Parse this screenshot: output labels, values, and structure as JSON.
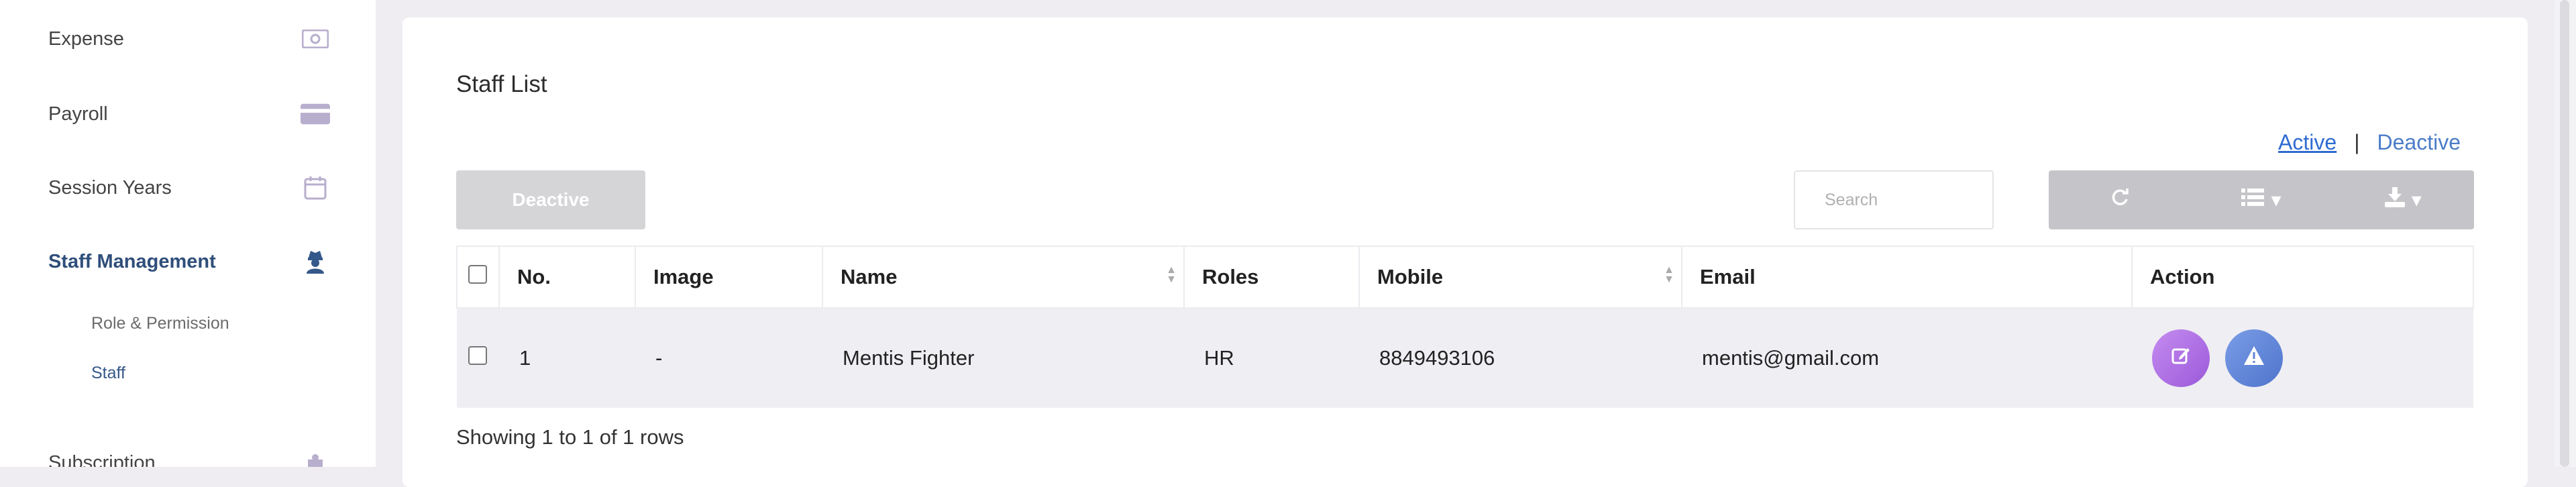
{
  "sidebar": {
    "items": [
      {
        "label": "Expense",
        "icon": "money-bill-icon"
      },
      {
        "label": "Payroll",
        "icon": "credit-card-icon"
      },
      {
        "label": "Session Years",
        "icon": "calendar-icon"
      },
      {
        "label": "Staff Management",
        "icon": "user-secret-icon",
        "active": true
      },
      {
        "label": "Subscription",
        "icon": "puzzle-icon"
      }
    ],
    "sub_items": [
      {
        "label": "Role & Permission"
      },
      {
        "label": "Staff",
        "active": true
      }
    ]
  },
  "card": {
    "title": "Staff List",
    "status": {
      "active_label": "Active",
      "separator": "|",
      "deactive_label": "Deactive"
    },
    "deactive_button": "Deactive",
    "search_placeholder": "Search"
  },
  "table": {
    "headers": [
      "No.",
      "Image",
      "Name",
      "Roles",
      "Mobile",
      "Email",
      "Action"
    ],
    "rows": [
      {
        "no": "1",
        "image": "-",
        "name": "Mentis Fighter",
        "role": "HR",
        "mobile": "8849493106",
        "email": "mentis@gmail.com"
      }
    ]
  },
  "footer": {
    "pagination_text": "Showing 1 to 1 of 1 rows"
  },
  "colors": {
    "accent": "#2f4e7a",
    "link": "#4a7cc8",
    "edit": "#b577e8",
    "warn": "#5f83d6"
  }
}
